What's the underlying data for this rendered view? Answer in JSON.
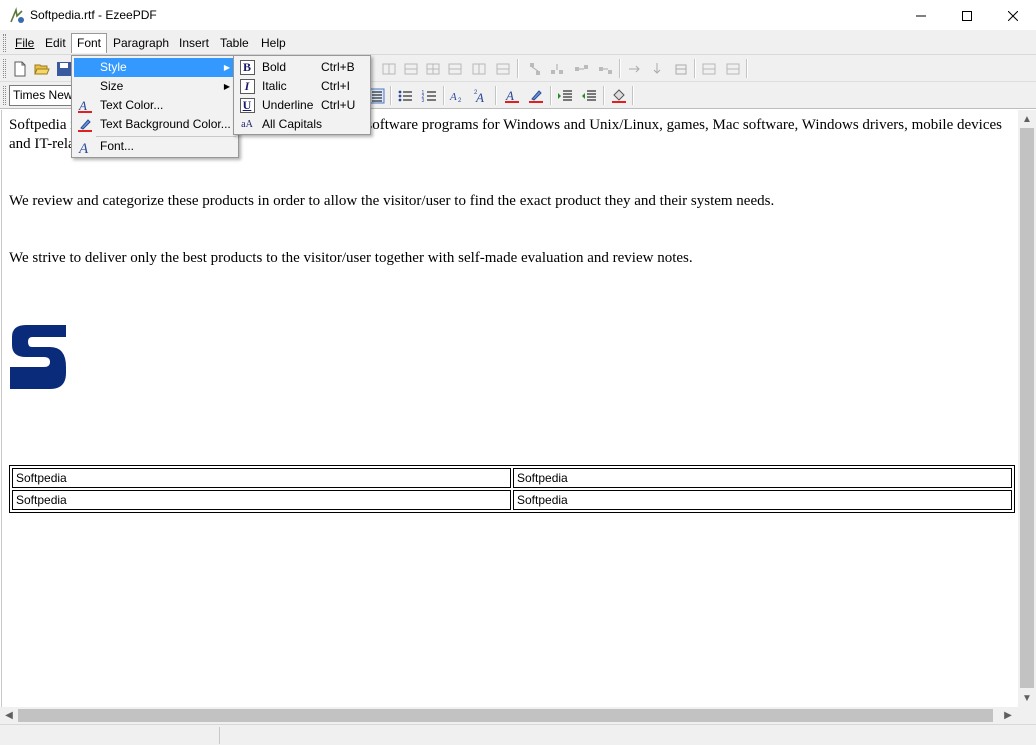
{
  "window": {
    "title": "Softpedia.rtf - EzeePDF",
    "minimize": "—",
    "maximize": "☐",
    "close": "✕"
  },
  "menubar": {
    "items": [
      "File",
      "Edit",
      "Font",
      "Paragraph",
      "Insert",
      "Table",
      "Help"
    ],
    "open_menu": "Font"
  },
  "toolbar2": {
    "font_name": "Times New Roman"
  },
  "font_menu": {
    "items": [
      {
        "label": "Style",
        "has_submenu": true,
        "highlighted": true
      },
      {
        "label": "Size",
        "has_submenu": true
      },
      {
        "label": "Text Color..."
      },
      {
        "label": "Text Background Color..."
      },
      {
        "label": "Font..."
      }
    ]
  },
  "style_menu": {
    "items": [
      {
        "label": "Bold",
        "shortcut": "Ctrl+B",
        "icon": "B"
      },
      {
        "label": "Italic",
        "shortcut": "Ctrl+I",
        "icon": "I"
      },
      {
        "label": "Underline",
        "shortcut": "Ctrl+U",
        "icon": "U"
      },
      {
        "label": "All Capitals",
        "icon": "aA"
      }
    ]
  },
  "document": {
    "paragraphs": [
      "Softpedia is a library of over 1,000,000 free and free-to-try software programs for Windows and Unix/Linux, games, Mac software, Windows drivers, mobile devices and IT-related articles.",
      "We review and categorize these products in order to allow the visitor/user to find the exact product they and their system needs.",
      "We strive to deliver only the best products to the visitor/user together with self-made evaluation and review notes."
    ],
    "table": [
      [
        "Softpedia",
        "Softpedia"
      ],
      [
        "Softpedia",
        "Softpedia"
      ]
    ]
  },
  "colors": {
    "menu_highlight": "#3399ff",
    "logo_blue": "#0a2a7a",
    "chrome": "#f0f0f0"
  }
}
